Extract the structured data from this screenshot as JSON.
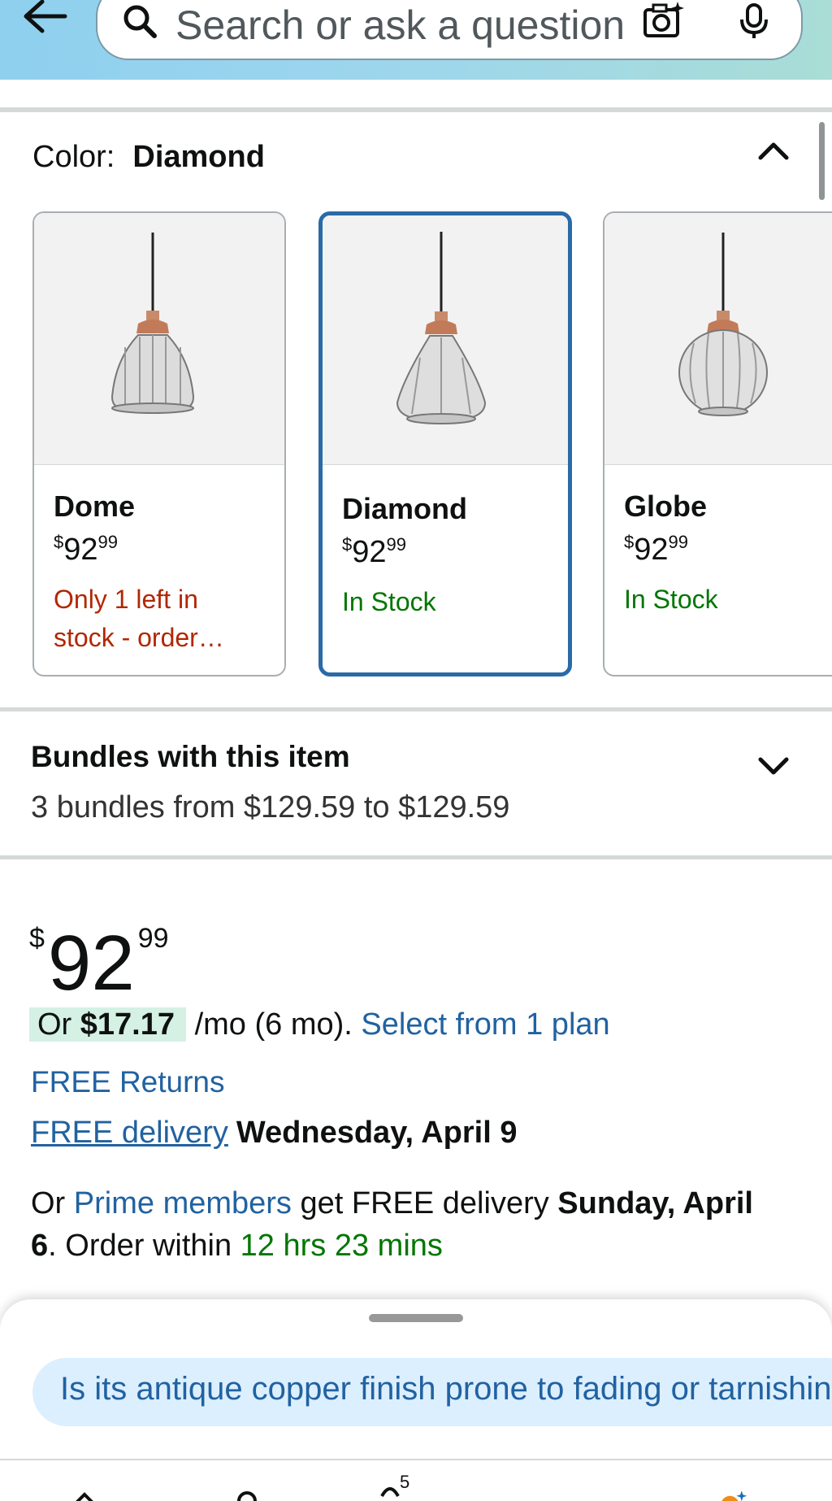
{
  "header": {
    "search_placeholder": "Search or ask a question"
  },
  "color_selector": {
    "label": "Color:",
    "selected": "Diamond",
    "options": [
      {
        "name": "Dome",
        "price_currency": "$",
        "price_whole": "92",
        "price_cents": "99",
        "stock": "Only 1 left in stock - order…",
        "stock_status": "low"
      },
      {
        "name": "Diamond",
        "price_currency": "$",
        "price_whole": "92",
        "price_cents": "99",
        "stock": "In Stock",
        "stock_status": "in-stock"
      },
      {
        "name": "Globe",
        "price_currency": "$",
        "price_whole": "92",
        "price_cents": "99",
        "stock": "In Stock",
        "stock_status": "in-stock"
      }
    ]
  },
  "bundles": {
    "title": "Bundles with this item",
    "subtitle": "3 bundles from $129.59 to $129.59"
  },
  "price": {
    "currency": "$",
    "whole": "92",
    "cents": "99"
  },
  "installment": {
    "prefix": "Or",
    "amount": "$17.17",
    "terms": "/mo (6 mo).",
    "link": "Select from 1 plan"
  },
  "returns": {
    "label": "FREE Returns"
  },
  "delivery": {
    "link": "FREE delivery",
    "date": "Wednesday, April 9"
  },
  "prime": {
    "prefix": "Or",
    "link": "Prime members",
    "mid": "get FREE delivery",
    "date_part1": "Sunday, April",
    "date_part2": "6",
    "order_text": ". Order within",
    "countdown": "12 hrs 23 mins"
  },
  "bottom_sheet": {
    "suggestion": "Is its antique copper finish prone to fading or tarnishing?"
  },
  "colors": {
    "link_blue": "#2162a1",
    "in_stock_green": "#007600",
    "low_stock_red": "#b12704",
    "selected_border": "#2a6aa7"
  }
}
